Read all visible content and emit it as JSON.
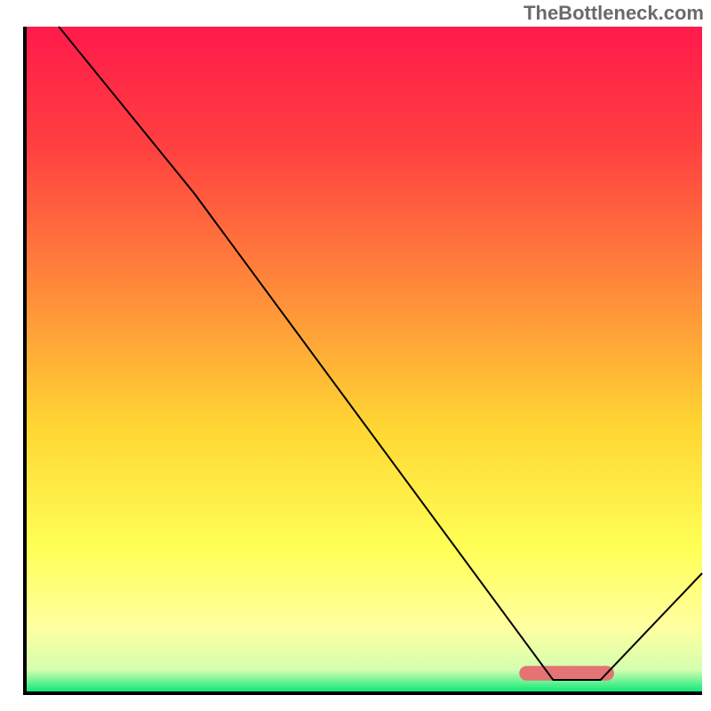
{
  "watermark": "TheBottleneck.com",
  "chart_data": {
    "type": "line",
    "title": "",
    "xlabel": "",
    "ylabel": "",
    "xlim": [
      0,
      100
    ],
    "ylim": [
      0,
      100
    ],
    "grid": false,
    "series": [
      {
        "name": "curve",
        "x": [
          5,
          25,
          78,
          85,
          100
        ],
        "y": [
          100,
          75,
          2,
          2,
          18
        ],
        "stroke": "#000000",
        "stroke_width": 2
      }
    ],
    "background_gradient": {
      "stops": [
        {
          "offset": 0.0,
          "color": "#ff1a4b"
        },
        {
          "offset": 0.18,
          "color": "#ff4040"
        },
        {
          "offset": 0.4,
          "color": "#ff8c3a"
        },
        {
          "offset": 0.6,
          "color": "#ffd633"
        },
        {
          "offset": 0.78,
          "color": "#ffff55"
        },
        {
          "offset": 0.9,
          "color": "#ffffa0"
        },
        {
          "offset": 0.965,
          "color": "#d4ffb0"
        },
        {
          "offset": 1.0,
          "color": "#00e676"
        }
      ]
    },
    "highlight_bar": {
      "x_start": 73,
      "x_end": 87,
      "y_center": 3,
      "height": 2.2,
      "color": "#e57373"
    },
    "axes": {
      "color": "#000000",
      "width": 4
    }
  }
}
